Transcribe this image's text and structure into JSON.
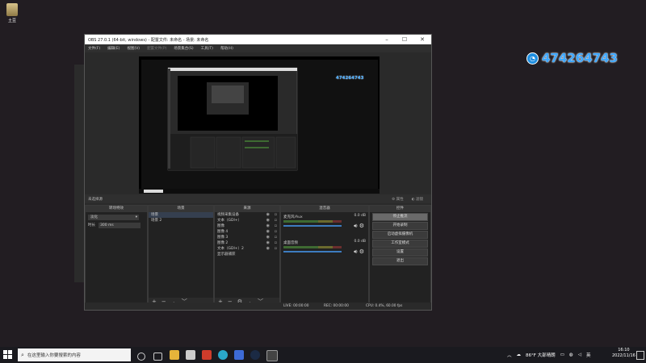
{
  "desktop": {
    "icon_label": "土豆"
  },
  "watermark": {
    "qq_number": "474264743"
  },
  "obs": {
    "title": "OBS 27.0.1 (64-bit, windows) - 配置文件: 未命名 - 场景: 未命名",
    "menu": [
      "文件(F)",
      "编辑(E)",
      "视图(V)",
      "配置文件(P)",
      "场景集合(S)",
      "工具(T)",
      "帮助(H)"
    ],
    "preview_watermark": "474264743",
    "scene_bar": {
      "name": "未选择源",
      "props": "属性",
      "filters": "滤镜"
    },
    "docks": {
      "transitions": {
        "title": "转场特效",
        "type": "淡化",
        "duration_label": "时长",
        "duration_value": "300 ms"
      },
      "scenes": {
        "title": "场景",
        "items": [
          "场景",
          "场景 2"
        ]
      },
      "sources": {
        "title": "来源",
        "items": [
          "视频采集设备",
          "文本（GDI+）",
          "图像",
          "图像 4",
          "图像 3",
          "图像 2",
          "文本（GDI+）2",
          "显示器捕获"
        ]
      },
      "mixer": {
        "title": "混音器",
        "channels": [
          {
            "name": "麦克风/Aux",
            "db": "0.0 dB"
          },
          {
            "name": "桌面音频",
            "db": "0.0 dB"
          }
        ]
      },
      "controls": {
        "title": "控件",
        "buttons": [
          "停止推流",
          "开始录制",
          "启动虚拟摄像机",
          "工作室模式",
          "设置",
          "退出"
        ]
      }
    },
    "status": {
      "live": "LIVE: 00:00:00",
      "rec": "REC: 00:00:00",
      "cpu": "CPU: 0.4%, 60.00 fps"
    }
  },
  "taskbar": {
    "search_placeholder": "在这里输入你要搜索的内容",
    "weather": "86°F 大部晴朗",
    "lang": "英",
    "time": "16:10",
    "date": "2022/11/16"
  },
  "colors": {
    "qq_blue": "#3ea7ff",
    "mixer_slider": "#3d7cc0"
  }
}
